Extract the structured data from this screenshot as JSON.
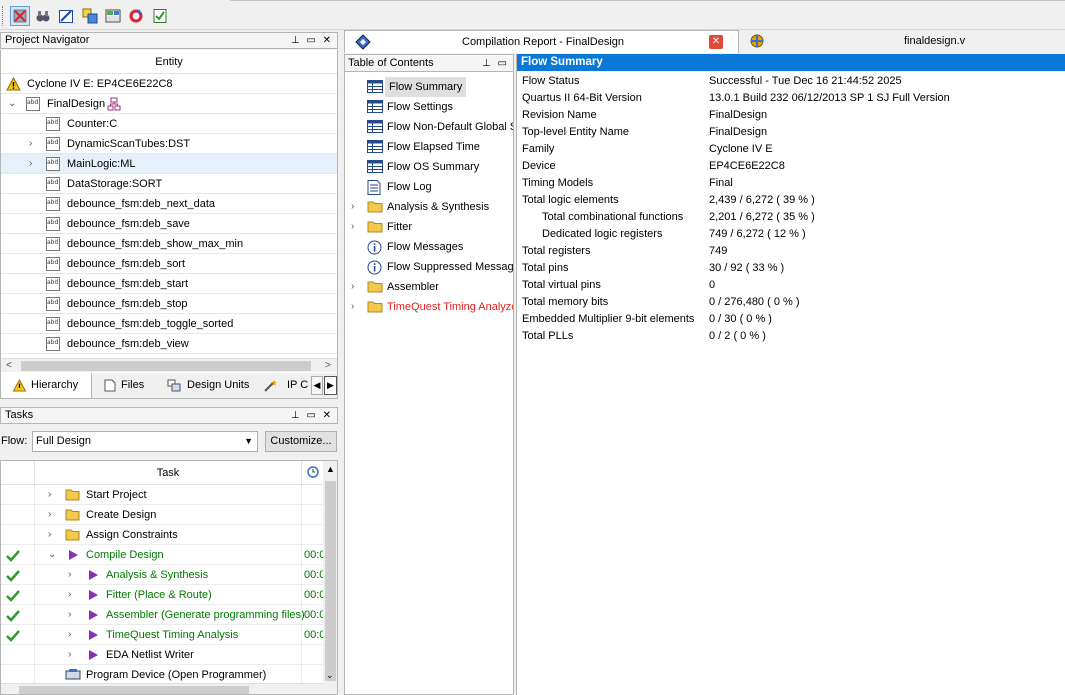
{
  "navigator": {
    "title": "Project Navigator",
    "column_header": "Entity",
    "device": "Cyclone IV E: EP4CE6E22C8",
    "top_entity": "FinalDesign",
    "entities": [
      {
        "label": "Counter:C",
        "expandable": false
      },
      {
        "label": "DynamicScanTubes:DST",
        "expandable": true
      },
      {
        "label": "MainLogic:ML",
        "expandable": true
      },
      {
        "label": "DataStorage:SORT",
        "expandable": false
      },
      {
        "label": "debounce_fsm:deb_next_data",
        "expandable": false
      },
      {
        "label": "debounce_fsm:deb_save",
        "expandable": false
      },
      {
        "label": "debounce_fsm:deb_show_max_min",
        "expandable": false
      },
      {
        "label": "debounce_fsm:deb_sort",
        "expandable": false
      },
      {
        "label": "debounce_fsm:deb_start",
        "expandable": false
      },
      {
        "label": "debounce_fsm:deb_stop",
        "expandable": false
      },
      {
        "label": "debounce_fsm:deb_toggle_sorted",
        "expandable": false
      },
      {
        "label": "debounce_fsm:deb_view",
        "expandable": false
      }
    ],
    "tabs": [
      "Hierarchy",
      "Files",
      "Design Units",
      "IP C"
    ]
  },
  "tasks": {
    "title": "Tasks",
    "flow_label": "Flow:",
    "flow_value": "Full Design",
    "customize_label": "Customize...",
    "column_header": "Task",
    "items": [
      {
        "label": "Start Project",
        "level": 0,
        "done": false,
        "time": ""
      },
      {
        "label": "Create Design",
        "level": 0,
        "done": false,
        "time": ""
      },
      {
        "label": "Assign Constraints",
        "level": 0,
        "done": false,
        "time": ""
      },
      {
        "label": "Compile Design",
        "level": 0,
        "done": true,
        "time": "00:0"
      },
      {
        "label": "Analysis & Synthesis",
        "level": 1,
        "done": true,
        "time": "00:0"
      },
      {
        "label": "Fitter (Place & Route)",
        "level": 1,
        "done": true,
        "time": "00:0"
      },
      {
        "label": "Assembler (Generate programming files)",
        "level": 1,
        "done": true,
        "time": "00:0"
      },
      {
        "label": "TimeQuest Timing Analysis",
        "level": 1,
        "done": true,
        "time": "00:0"
      },
      {
        "label": "EDA Netlist Writer",
        "level": 1,
        "done": false,
        "time": ""
      },
      {
        "label": "Program Device (Open Programmer)",
        "level": 0,
        "done": false,
        "time": ""
      }
    ]
  },
  "report": {
    "tab_title": "Compilation Report - FinalDesign",
    "file_tab": "finaldesign.v",
    "toc_title": "Table of Contents",
    "toc": [
      {
        "label": "Flow Summary",
        "icon": "table-icon",
        "selected": true
      },
      {
        "label": "Flow Settings",
        "icon": "table-icon"
      },
      {
        "label": "Flow Non-Default Global S",
        "icon": "table-icon"
      },
      {
        "label": "Flow Elapsed Time",
        "icon": "table-icon"
      },
      {
        "label": "Flow OS Summary",
        "icon": "table-icon"
      },
      {
        "label": "Flow Log",
        "icon": "document-icon"
      },
      {
        "label": "Analysis & Synthesis",
        "icon": "folder-icon",
        "expandable": true
      },
      {
        "label": "Fitter",
        "icon": "folder-icon",
        "expandable": true
      },
      {
        "label": "Flow Messages",
        "icon": "info-icon"
      },
      {
        "label": "Flow Suppressed Message",
        "icon": "info-icon"
      },
      {
        "label": "Assembler",
        "icon": "folder-icon",
        "expandable": true
      },
      {
        "label": "TimeQuest Timing Analyze",
        "icon": "folder-icon",
        "expandable": true,
        "red": true
      }
    ],
    "summary_title": "Flow Summary",
    "summary": [
      {
        "key": "Flow Status",
        "value": "Successful - Tue Dec 16 21:44:52 2025"
      },
      {
        "key": "Quartus II 64-Bit Version",
        "value": "13.0.1 Build 232 06/12/2013 SP 1 SJ Full Version"
      },
      {
        "key": "Revision Name",
        "value": "FinalDesign"
      },
      {
        "key": "Top-level Entity Name",
        "value": "FinalDesign"
      },
      {
        "key": "Family",
        "value": "Cyclone IV E"
      },
      {
        "key": "Device",
        "value": "EP4CE6E22C8"
      },
      {
        "key": "Timing Models",
        "value": "Final"
      },
      {
        "key": "Total logic elements",
        "value": "2,439 / 6,272 ( 39 % )"
      },
      {
        "key": "Total combinational functions",
        "value": "2,201 / 6,272 ( 35 % )",
        "indent": true
      },
      {
        "key": "Dedicated logic registers",
        "value": "749 / 6,272 ( 12 % )",
        "indent": true
      },
      {
        "key": "Total registers",
        "value": "749"
      },
      {
        "key": "Total pins",
        "value": "30 / 92 ( 33 % )"
      },
      {
        "key": "Total virtual pins",
        "value": "0"
      },
      {
        "key": "Total memory bits",
        "value": "0 / 276,480 ( 0 % )"
      },
      {
        "key": "Embedded Multiplier 9-bit elements",
        "value": "0 / 30 ( 0 % )"
      },
      {
        "key": "Total PLLs",
        "value": "0 / 2 ( 0 % )"
      }
    ]
  },
  "colors": {
    "accent": "#0a78d7",
    "success": "#007a00",
    "error_text": "#e02020"
  }
}
